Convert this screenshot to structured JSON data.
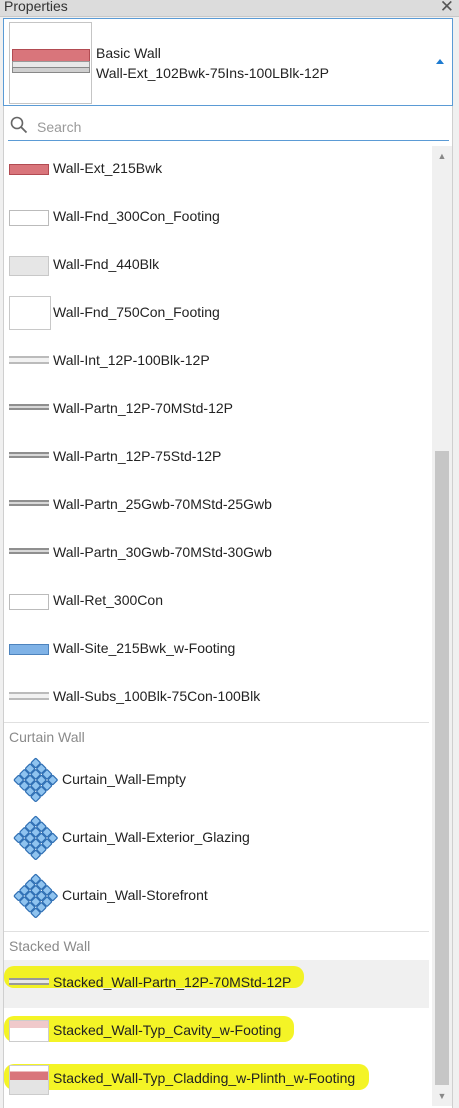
{
  "panel": {
    "title": "Properties",
    "close_icon": "close-icon"
  },
  "type_selector": {
    "family": "Basic Wall",
    "type": "Wall-Ext_102Bwk-75Ins-100LBlk-12P"
  },
  "search": {
    "placeholder": "Search",
    "value": ""
  },
  "basic_wall_items": [
    {
      "label": "Wall-Ext_215Bwk",
      "swatch": "red"
    },
    {
      "label": "Wall-Fnd_300Con_Footing",
      "swatch": "white"
    },
    {
      "label": "Wall-Fnd_440Blk",
      "swatch": "gray"
    },
    {
      "label": "Wall-Fnd_750Con_Footing",
      "swatch": "tall"
    },
    {
      "label": "Wall-Int_12P-100Blk-12P",
      "swatch": "lines"
    },
    {
      "label": "Wall-Partn_12P-70MStd-12P",
      "swatch": "dark"
    },
    {
      "label": "Wall-Partn_12P-75Std-12P",
      "swatch": "dark"
    },
    {
      "label": "Wall-Partn_25Gwb-70MStd-25Gwb",
      "swatch": "dark"
    },
    {
      "label": "Wall-Partn_30Gwb-70MStd-30Gwb",
      "swatch": "dark"
    },
    {
      "label": "Wall-Ret_300Con",
      "swatch": "white"
    },
    {
      "label": "Wall-Site_215Bwk_w-Footing",
      "swatch": "blue"
    },
    {
      "label": "Wall-Subs_100Blk-75Con-100Blk",
      "swatch": "lines"
    }
  ],
  "groups": {
    "curtain_wall": "Curtain Wall",
    "stacked_wall": "Stacked Wall"
  },
  "curtain_items": [
    {
      "label": "Curtain_Wall-Empty"
    },
    {
      "label": "Curtain_Wall-Exterior_Glazing"
    },
    {
      "label": "Curtain_Wall-Storefront"
    }
  ],
  "stacked_items": [
    {
      "label": "Stacked_Wall-Partn_12P-70MStd-12P"
    },
    {
      "label": "Stacked_Wall-Typ_Cavity_w-Footing"
    },
    {
      "label": "Stacked_Wall-Typ_Cladding_w-Plinth_w-Footing"
    }
  ],
  "colors": {
    "brick_red": "#d9757b",
    "accent_blue": "#5b9bd5",
    "highlight_yellow": "#f2f200",
    "site_blue": "#7fb2e6"
  },
  "scrollbar": {
    "up_icon": "chevron-up-icon",
    "down_icon": "chevron-down-icon"
  }
}
